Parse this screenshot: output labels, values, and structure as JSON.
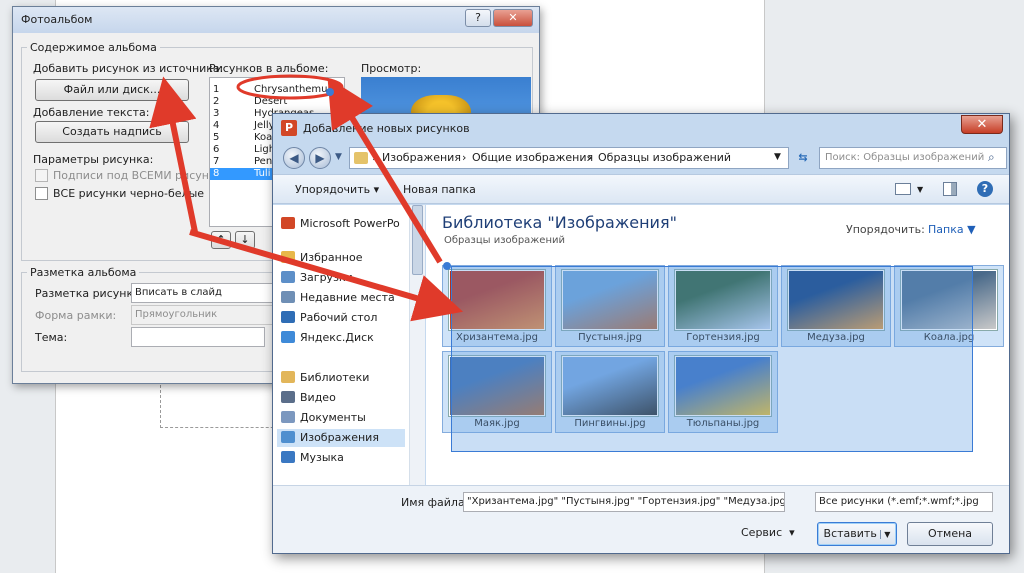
{
  "album": {
    "title": "Фотоальбом",
    "help_glyph": "?",
    "close_glyph": "✕",
    "content_group": "Содержимое альбома",
    "insert_from": "Добавить рисунок из источника:",
    "file_button": "Файл или диск...",
    "add_text": "Добавление текста:",
    "caption_button": "Создать надпись",
    "picture_options": "Параметры рисунка:",
    "captions_option": "Подписи под ВСЕМИ рисунками",
    "bw_option": "ВСЕ рисунки черно-белые",
    "pictures_label": "Рисунков в альбоме:",
    "pictures": [
      {
        "num": "1",
        "name": "Chrysanthemum"
      },
      {
        "num": "2",
        "name": "Desert"
      },
      {
        "num": "3",
        "name": "Hydrangeas"
      },
      {
        "num": "4",
        "name": "Jelly"
      },
      {
        "num": "5",
        "name": "Koa"
      },
      {
        "num": "6",
        "name": "Ligh"
      },
      {
        "num": "7",
        "name": "Pen"
      },
      {
        "num": "8",
        "name": "Tuli"
      }
    ],
    "preview_label": "Просмотр:",
    "layout_group": "Разметка альбома",
    "layout_label": "Разметка рисунка:",
    "layout_value": "Вписать в слайд",
    "frame_label": "Форма рамки:",
    "frame_value": "Прямоугольник",
    "theme_label": "Тема:",
    "theme_value": ""
  },
  "file_dialog": {
    "title": "Добавление новых рисунков",
    "path": [
      "Изображения",
      "Общие изображения",
      "Образцы изображений"
    ],
    "search_placeholder": "Поиск: Образцы изображений",
    "organize": "Упорядочить",
    "new_folder": "Новая папка",
    "nav": [
      {
        "label": "Microsoft PowerPo",
        "color": "#d24726"
      },
      {
        "label": "Избранное",
        "color": "#e8b84a"
      },
      {
        "label": "Загрузки",
        "color": "#5d8fc8"
      },
      {
        "label": "Недавние места",
        "color": "#6f8fb5"
      },
      {
        "label": "Рабочий стол",
        "color": "#2f6db5"
      },
      {
        "label": "Яндекс.Диск",
        "color": "#3f8ad8"
      },
      {
        "label": "Библиотеки",
        "color": "#e2b65a"
      },
      {
        "label": "Видео",
        "color": "#5b6e8a"
      },
      {
        "label": "Документы",
        "color": "#7c98bf"
      },
      {
        "label": "Изображения",
        "color": "#4f8fcf"
      },
      {
        "label": "Музыка",
        "color": "#3a78c2"
      }
    ],
    "library_title": "Библиотека \"Изображения\"",
    "library_subtitle": "Образцы изображений",
    "arrange_label": "Упорядочить:",
    "arrange_value": "Папка",
    "files": [
      {
        "name": "Хризантема.jpg",
        "c1": "#b8321e",
        "c2": "#f08a3a"
      },
      {
        "name": "Пустыня.jpg",
        "c1": "#6fa3d8",
        "c2": "#b8683a"
      },
      {
        "name": "Гортензия.jpg",
        "c1": "#2f5f3a",
        "c2": "#c9d7f0"
      },
      {
        "name": "Медуза.jpg",
        "c1": "#0d3a7a",
        "c2": "#e89a3a"
      },
      {
        "name": "Коала.jpg",
        "c1": "#4a6a8a",
        "c2": "#c9c9c9"
      },
      {
        "name": "Маяк.jpg",
        "c1": "#3f6fb0",
        "c2": "#b06a3a"
      },
      {
        "name": "Пингвины.jpg",
        "c1": "#7aa8e0",
        "c2": "#2a2a2a"
      },
      {
        "name": "Тюльпаны.jpg",
        "c1": "#3a6fc0",
        "c2": "#f0c02a"
      }
    ],
    "filename_label": "Имя файла:",
    "filename_value": "\"Хризантема.jpg\" \"Пустыня.jpg\" \"Гортензия.jpg\" \"Медуза.jpg\" \"",
    "filter_value": "Все рисунки (*.emf;*.wmf;*.jpg",
    "service": "Сервис",
    "insert": "Вставить",
    "cancel": "Отмена"
  },
  "colors": {
    "annotation_arrow": "#e03a2a",
    "selection": "#3a7bd5"
  }
}
